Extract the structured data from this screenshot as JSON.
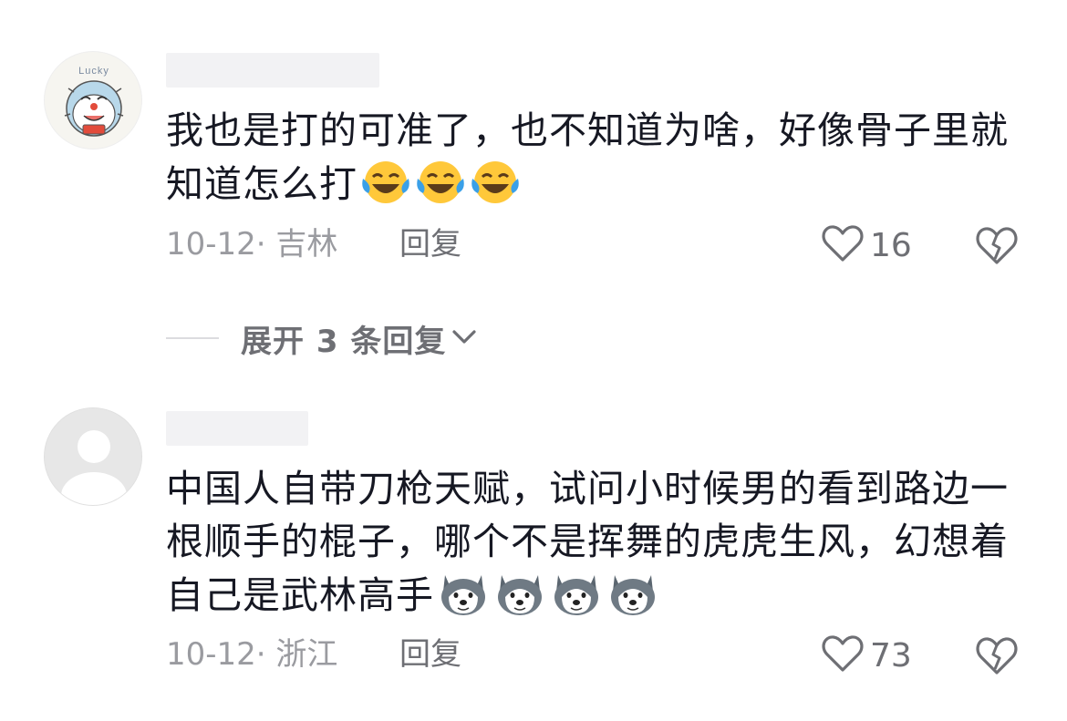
{
  "comments": [
    {
      "avatar_icon": "doraemon-avatar-icon",
      "avatar_text": "Lucky",
      "text": "我也是打的可准了，也不知道为啥，好像骨子里就知道怎么打",
      "emoji_icon": "laugh-cry-emoji-icon",
      "emoji_count": 3,
      "date": "10-12· 吉林",
      "reply_label": "回复",
      "like_count": "16",
      "like_icon": "heart-outline-icon",
      "dislike_icon": "broken-heart-icon"
    },
    {
      "avatar_icon": "default-user-avatar-icon",
      "text": "中国人自带刀枪天赋，试问小时候男的看到路边一根顺手的棍子，哪个不是挥舞的虎虎生风，幻想着自己是武林高手",
      "emoji_icon": "husky-dog-emoji-icon",
      "emoji_count": 4,
      "date": "10-12· 浙江",
      "reply_label": "回复",
      "like_count": "73",
      "like_icon": "heart-outline-icon",
      "dislike_icon": "broken-heart-icon"
    }
  ],
  "expand_replies": {
    "label": "展开 3 条回复",
    "icon": "chevron-down-icon"
  },
  "colors": {
    "text": "#161823",
    "meta": "#9a9ba0",
    "action": "#6e6f74",
    "placeholder": "#f2f2f4"
  }
}
